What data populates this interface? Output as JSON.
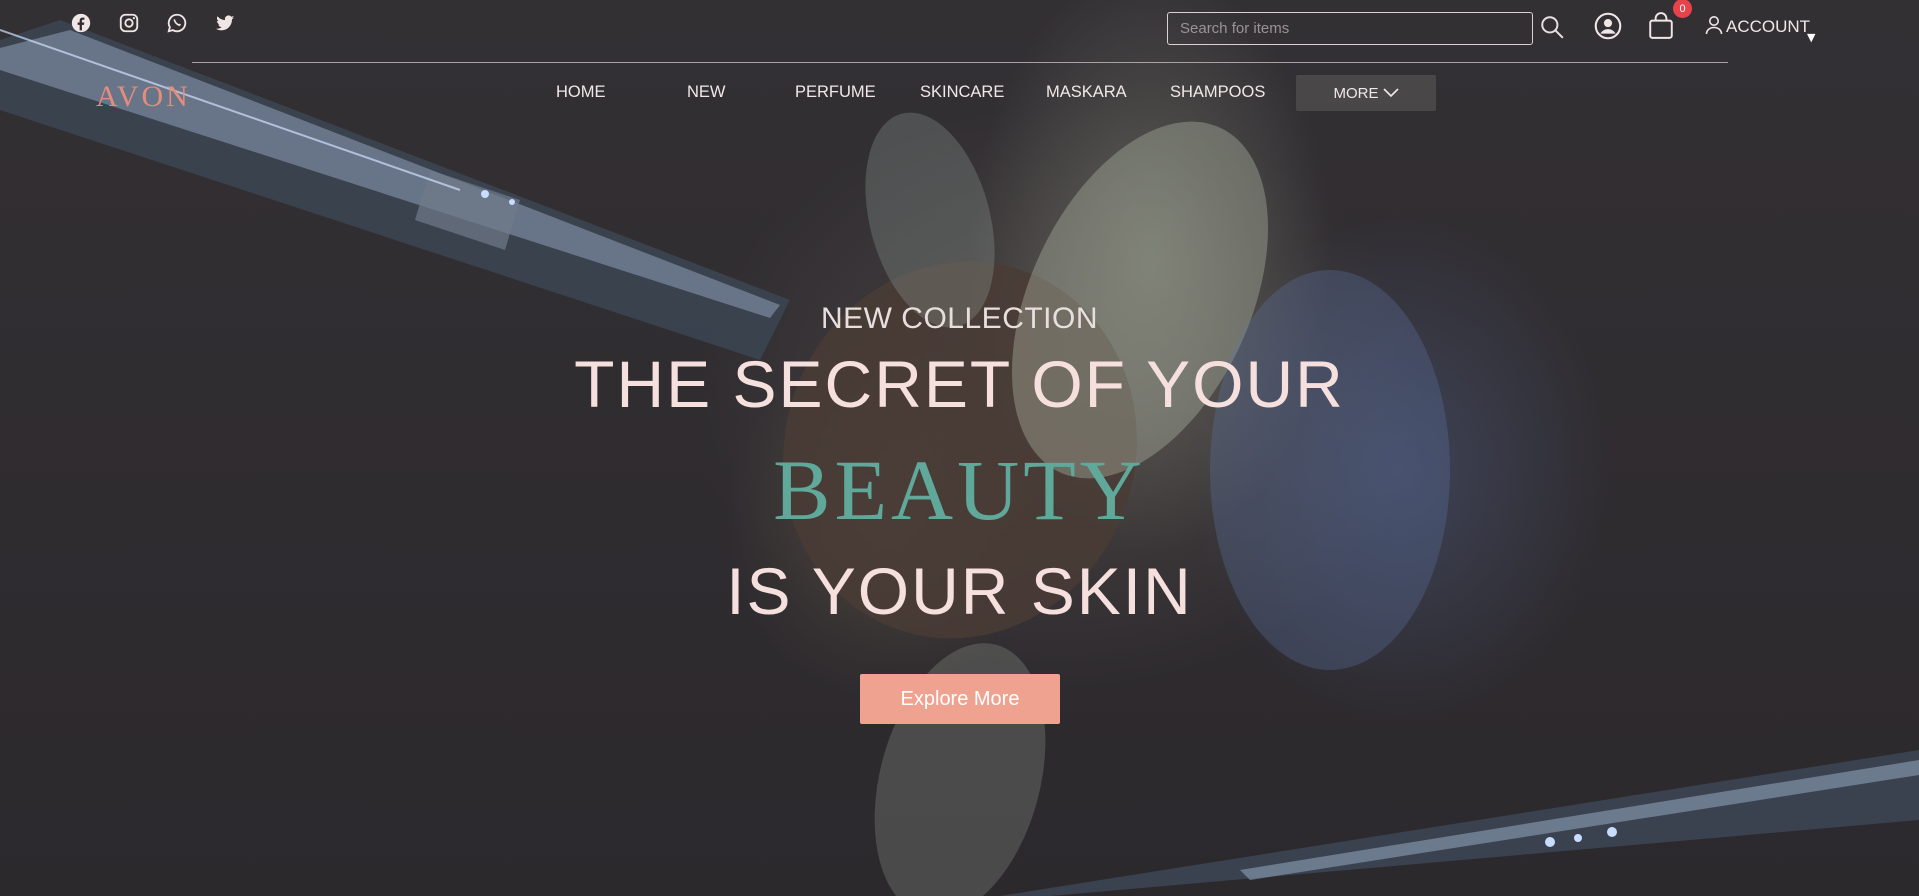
{
  "social": {
    "icons": [
      "facebook-icon",
      "instagram-icon",
      "whatsapp-icon",
      "twitter-icon"
    ]
  },
  "search": {
    "placeholder": "Search for items",
    "value": ""
  },
  "header": {
    "cart_count": "0",
    "account_label": "ACCOUNT"
  },
  "logo": {
    "text": "AVON"
  },
  "nav": {
    "items": [
      "HOME",
      "NEW",
      "PERFUME",
      "SKINCARE",
      "MASKARA",
      "SHAMPOOS"
    ],
    "more_label": "MORE"
  },
  "hero": {
    "kicker": "NEW COLLECTION",
    "line1": "THE SECRET OF YOUR",
    "highlight": "BEAUTY",
    "line3": "IS YOUR SKIN",
    "cta_label": "Explore More"
  },
  "colors": {
    "background": "#2f2b30",
    "accent_pink": "#f0a291",
    "accent_teal": "#5fa89a",
    "logo": "#e58c7d",
    "badge": "#e8424a"
  }
}
